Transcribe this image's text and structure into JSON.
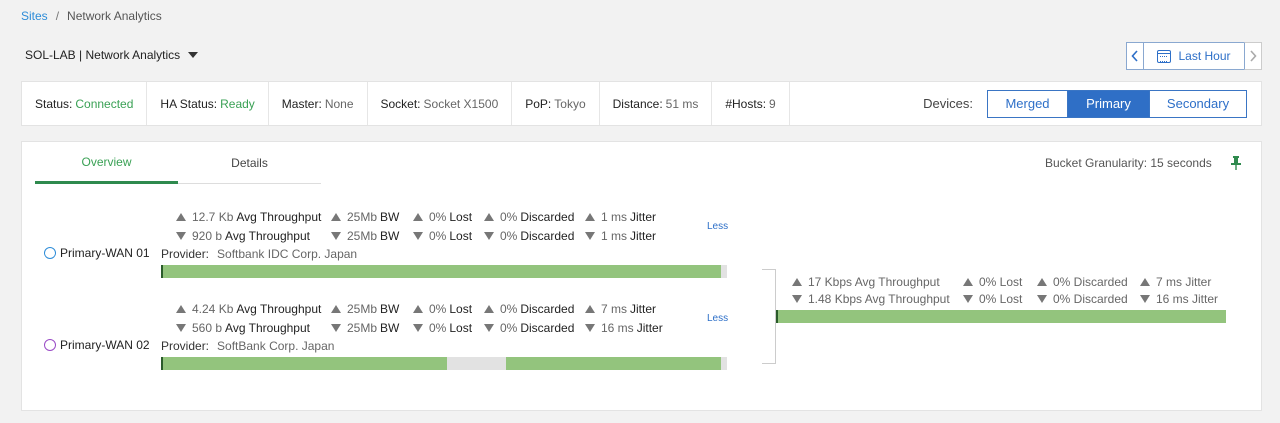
{
  "breadcrumb": {
    "root": "Sites",
    "separator": "/",
    "current": "Network Analytics"
  },
  "site_selector": {
    "label": "SOL-LAB | Network Analytics"
  },
  "time_range": {
    "label": "Last Hour"
  },
  "status_bar": [
    {
      "key": "Status:",
      "value": "Connected",
      "color": "#3aa155"
    },
    {
      "key": "HA Status:",
      "value": "Ready",
      "color": "#3aa155"
    },
    {
      "key": "Master:",
      "value": "None"
    },
    {
      "key": "Socket:",
      "value": "Socket X1500"
    },
    {
      "key": "PoP:",
      "value": "Tokyo"
    },
    {
      "key": "Distance:",
      "value": "51 ms"
    },
    {
      "key": "#Hosts:",
      "value": "9"
    }
  ],
  "devices": {
    "label": "Devices:",
    "options": [
      "Merged",
      "Primary",
      "Secondary"
    ],
    "selected": "Primary"
  },
  "tabs": [
    {
      "label": "Overview",
      "active": true
    },
    {
      "label": "Details",
      "active": false
    }
  ],
  "bucket": "Bucket Granularity: 15 seconds",
  "links": [
    {
      "name": "Primary-WAN 01",
      "less": "Less",
      "provider_label": "Provider:",
      "provider": "Softbank IDC Corp. Japan",
      "up": {
        "throughput_n": "12.7 Kb",
        "throughput_u": "Avg Throughput",
        "bw_n": "25Mb",
        "bw_u": "BW",
        "lost_n": "0%",
        "lost_u": "Lost",
        "disc_n": "0%",
        "disc_u": "Discarded",
        "jitter_n": "1 ms",
        "jitter_u": "Jitter"
      },
      "down": {
        "throughput_n": "920 b",
        "throughput_u": "Avg Throughput",
        "bw_n": "25Mb",
        "bw_u": "BW",
        "lost_n": "0%",
        "lost_u": "Lost",
        "disc_n": "0%",
        "disc_u": "Discarded",
        "jitter_n": "1 ms",
        "jitter_u": "Jitter"
      },
      "bar_segments": [
        [
          0,
          0.99
        ]
      ]
    },
    {
      "name": "Primary-WAN 02",
      "less": "Less",
      "provider_label": "Provider:",
      "provider": "SoftBank Corp. Japan",
      "up": {
        "throughput_n": "4.24 Kb",
        "throughput_u": "Avg Throughput",
        "bw_n": "25Mb",
        "bw_u": "BW",
        "lost_n": "0%",
        "lost_u": "Lost",
        "disc_n": "0%",
        "disc_u": "Discarded",
        "jitter_n": "7 ms",
        "jitter_u": "Jitter"
      },
      "down": {
        "throughput_n": "560 b",
        "throughput_u": "Avg Throughput",
        "bw_n": "25Mb",
        "bw_u": "BW",
        "lost_n": "0%",
        "lost_u": "Lost",
        "disc_n": "0%",
        "disc_u": "Discarded",
        "jitter_n": "16 ms",
        "jitter_u": "Jitter"
      },
      "bar_segments": [
        [
          0,
          0.505
        ],
        [
          0.61,
          0.99
        ]
      ]
    }
  ],
  "merged": {
    "up": {
      "throughput": "17 Kbps Avg Throughput",
      "lost": "0% Lost",
      "disc": "0% Discarded",
      "jitter": "7 ms Jitter"
    },
    "down": {
      "throughput": "1.48 Kbps Avg Throughput",
      "lost": "0% Lost",
      "disc": "0% Discarded",
      "jitter": "16 ms Jitter"
    },
    "bar_segments": [
      [
        0,
        1.0
      ]
    ]
  }
}
